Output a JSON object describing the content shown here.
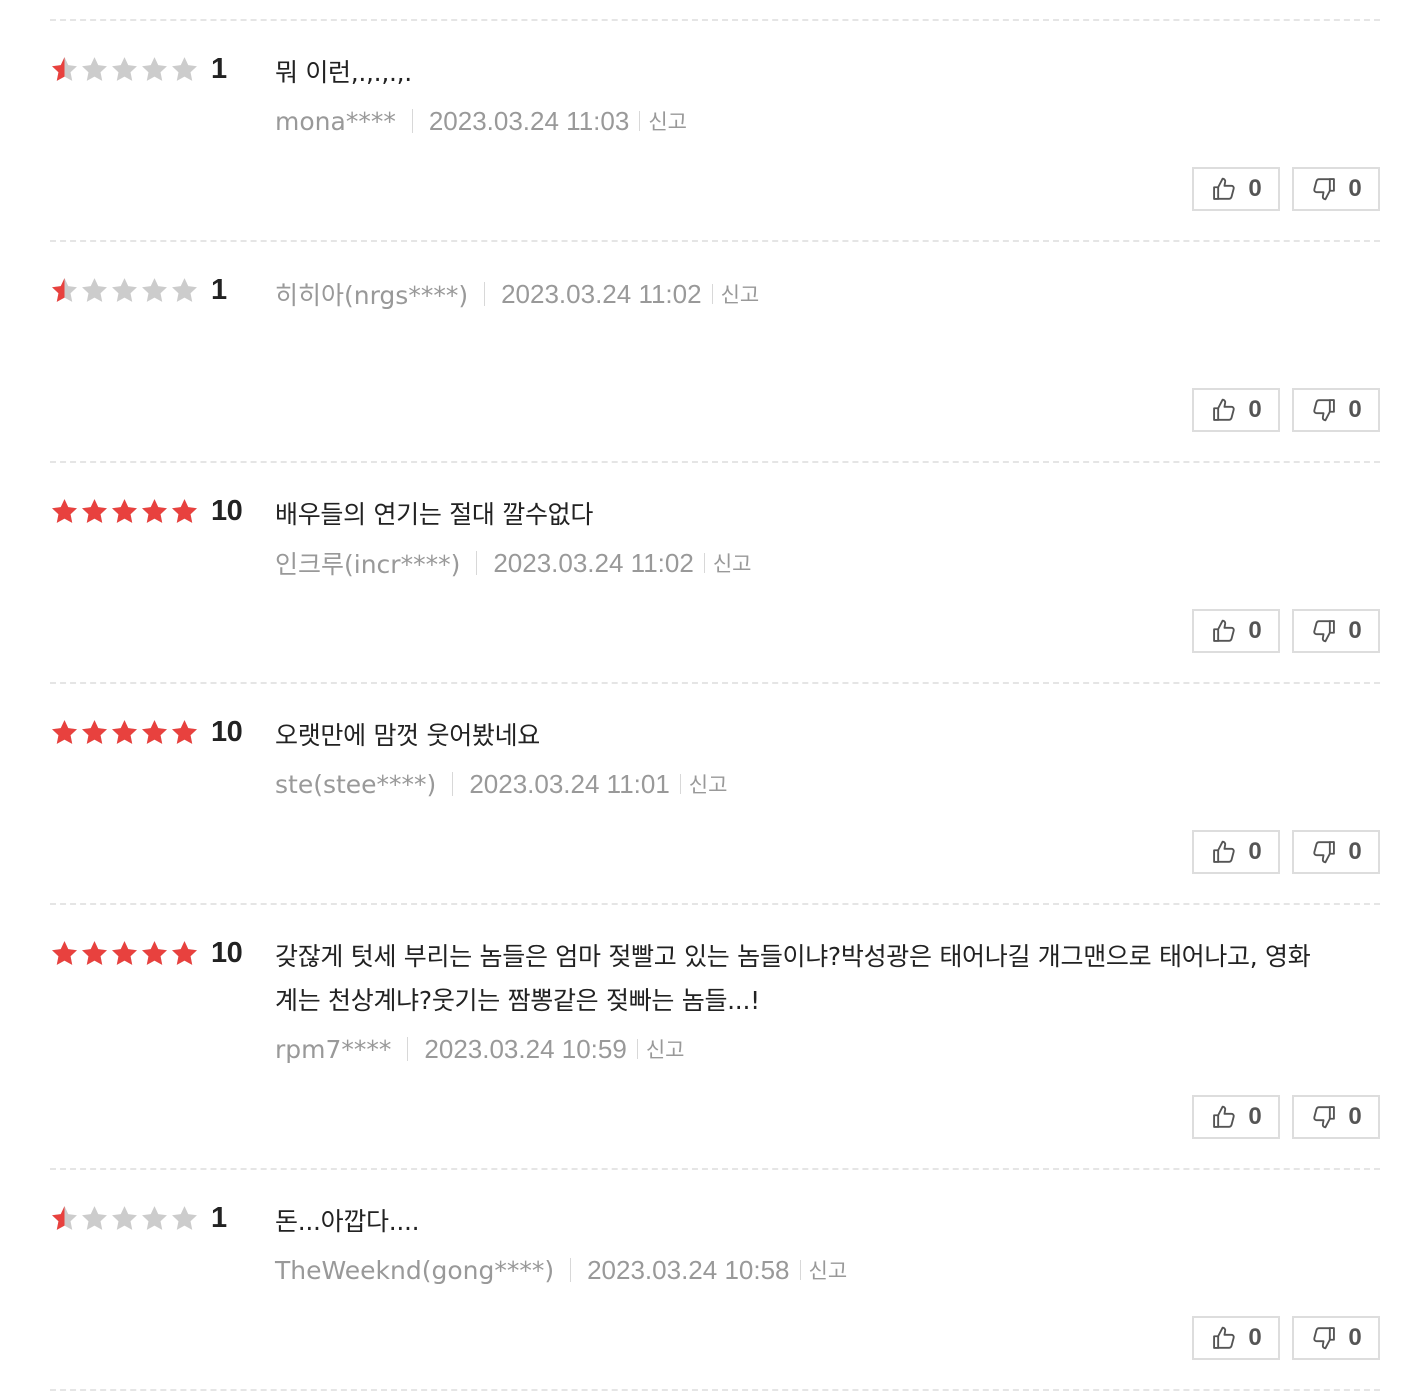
{
  "colors": {
    "star_on": "#e8413e",
    "star_off": "#cccccc",
    "meta_text": "#999999",
    "divider": "#e5e5e5"
  },
  "icons": {
    "like": "thumbs-up-icon",
    "dislike": "thumbs-down-icon",
    "star": "star-icon"
  },
  "reviews": [
    {
      "stars": 0.5,
      "score": "1",
      "comment": "뭐 이런,.,.,.,.",
      "user": "mona****",
      "date": "2023.03.24 11:03",
      "report": "신고",
      "likes": "0",
      "dislikes": "0"
    },
    {
      "stars": 0.5,
      "score": "1",
      "comment": "",
      "user": "히히아(nrgs****)",
      "date": "2023.03.24 11:02",
      "report": "신고",
      "likes": "0",
      "dislikes": "0"
    },
    {
      "stars": 5,
      "score": "10",
      "comment": "배우들의 연기는 절대 깔수없다",
      "user": "인크루(incr****)",
      "date": "2023.03.24 11:02",
      "report": "신고",
      "likes": "0",
      "dislikes": "0"
    },
    {
      "stars": 5,
      "score": "10",
      "comment": "오랫만에 맘껏 웃어봤네요",
      "user": "ste(stee****)",
      "date": "2023.03.24 11:01",
      "report": "신고",
      "likes": "0",
      "dislikes": "0"
    },
    {
      "stars": 5,
      "score": "10",
      "comment": "갖잖게 텃세 부리는 놈들은 엄마 젖빨고 있는 놈들이냐?박성광은 태어나길 개그맨으로 태어나고, 영화계는 천상계냐?웃기는 짬뽕같은 젖빠는 놈들...!",
      "user": "rpm7****",
      "date": "2023.03.24 10:59",
      "report": "신고",
      "likes": "0",
      "dislikes": "0"
    },
    {
      "stars": 0.5,
      "score": "1",
      "comment": "돈...아깝다....",
      "user": "TheWeeknd(gong****)",
      "date": "2023.03.24 10:58",
      "report": "신고",
      "likes": "0",
      "dislikes": "0"
    }
  ]
}
